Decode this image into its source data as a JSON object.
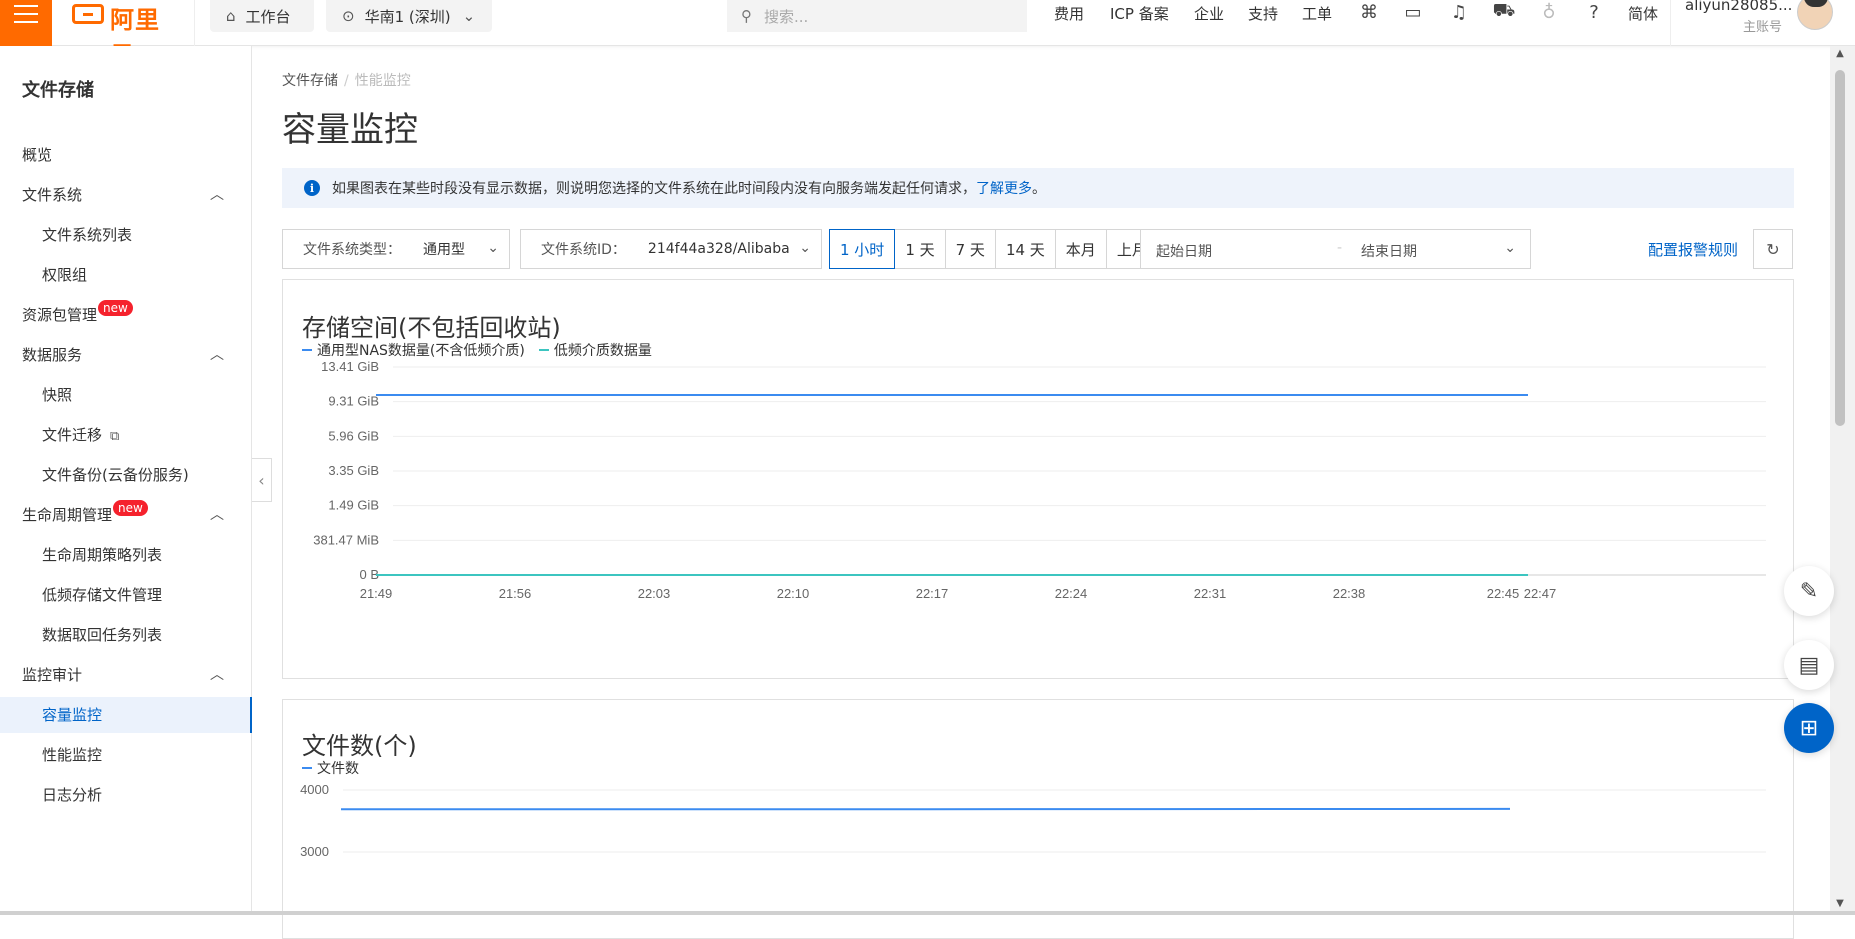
{
  "topbar": {
    "logo_text": "阿里云",
    "workbench": "工作台",
    "region": "华南1 (深圳)",
    "search_placeholder": "搜索...",
    "links": [
      "费用",
      "ICP 备案",
      "企业",
      "支持",
      "工单"
    ],
    "lang": "简体",
    "user_name": "aliyun28085...",
    "user_role": "主账号"
  },
  "sidebar": {
    "title": "文件存储",
    "items": [
      {
        "label": "概览"
      },
      {
        "label": "文件系统"
      },
      {
        "label": "文件系统列表"
      },
      {
        "label": "权限组"
      },
      {
        "label": "资源包管理",
        "badge": "new"
      },
      {
        "label": "数据服务"
      },
      {
        "label": "快照"
      },
      {
        "label": "文件迁移"
      },
      {
        "label": "文件备份(云备份服务)"
      },
      {
        "label": "生命周期管理",
        "badge": "new"
      },
      {
        "label": "生命周期策略列表"
      },
      {
        "label": "低频存储文件管理"
      },
      {
        "label": "数据取回任务列表"
      },
      {
        "label": "监控审计"
      },
      {
        "label": "容量监控"
      },
      {
        "label": "性能监控"
      },
      {
        "label": "日志分析"
      }
    ]
  },
  "main": {
    "breadcrumb": [
      "文件存储",
      "性能监控"
    ],
    "title": "容量监控",
    "notice": {
      "text": "如果图表在某些时段没有显示数据，则说明您选择的文件系统在此时间段内没有向服务端发起任何请求，",
      "link": "了解更多",
      "end": "。"
    },
    "filters": {
      "fs_type_label": "文件系统类型：",
      "fs_type_value": "通用型",
      "fs_id_label": "文件系统ID：",
      "fs_id_value": "214f44a328/Alibaba",
      "ranges": [
        "1 小时",
        "1 天",
        "7 天",
        "14 天",
        "本月",
        "上月"
      ],
      "active_range": "1 小时",
      "start_placeholder": "起始日期",
      "end_placeholder": "结束日期",
      "alarm_link": "配置报警规则"
    }
  },
  "colors": {
    "accent": "#0064c8",
    "brand": "#ff6a00",
    "series_blue": "#3b8bf0",
    "series_teal": "#3cc5c0"
  },
  "chart_data": [
    {
      "type": "line",
      "title": "存储空间(不包括回收站)",
      "y_ticks": [
        "13.41 GiB",
        "9.31 GiB",
        "5.96 GiB",
        "3.35 GiB",
        "1.49 GiB",
        "381.47 MiB",
        "0 B"
      ],
      "x_ticks": [
        "21:49",
        "21:56",
        "22:03",
        "22:10",
        "22:17",
        "22:24",
        "22:31",
        "22:38",
        "22:45",
        "22:47"
      ],
      "series": [
        {
          "name": "通用型NAS数据量(不含低频介质)",
          "color": "#3b8bf0",
          "values_gib": [
            10.1,
            10.1
          ]
        },
        {
          "name": "低频介质数据量",
          "color": "#3cc5c0",
          "values_gib": [
            0,
            0
          ]
        }
      ]
    },
    {
      "type": "line",
      "title": "文件数(个)",
      "y_ticks": [
        "4000",
        "3000"
      ],
      "series": [
        {
          "name": "文件数",
          "color": "#3b8bf0",
          "values": [
            3690,
            3690,
            3695
          ]
        }
      ]
    }
  ]
}
